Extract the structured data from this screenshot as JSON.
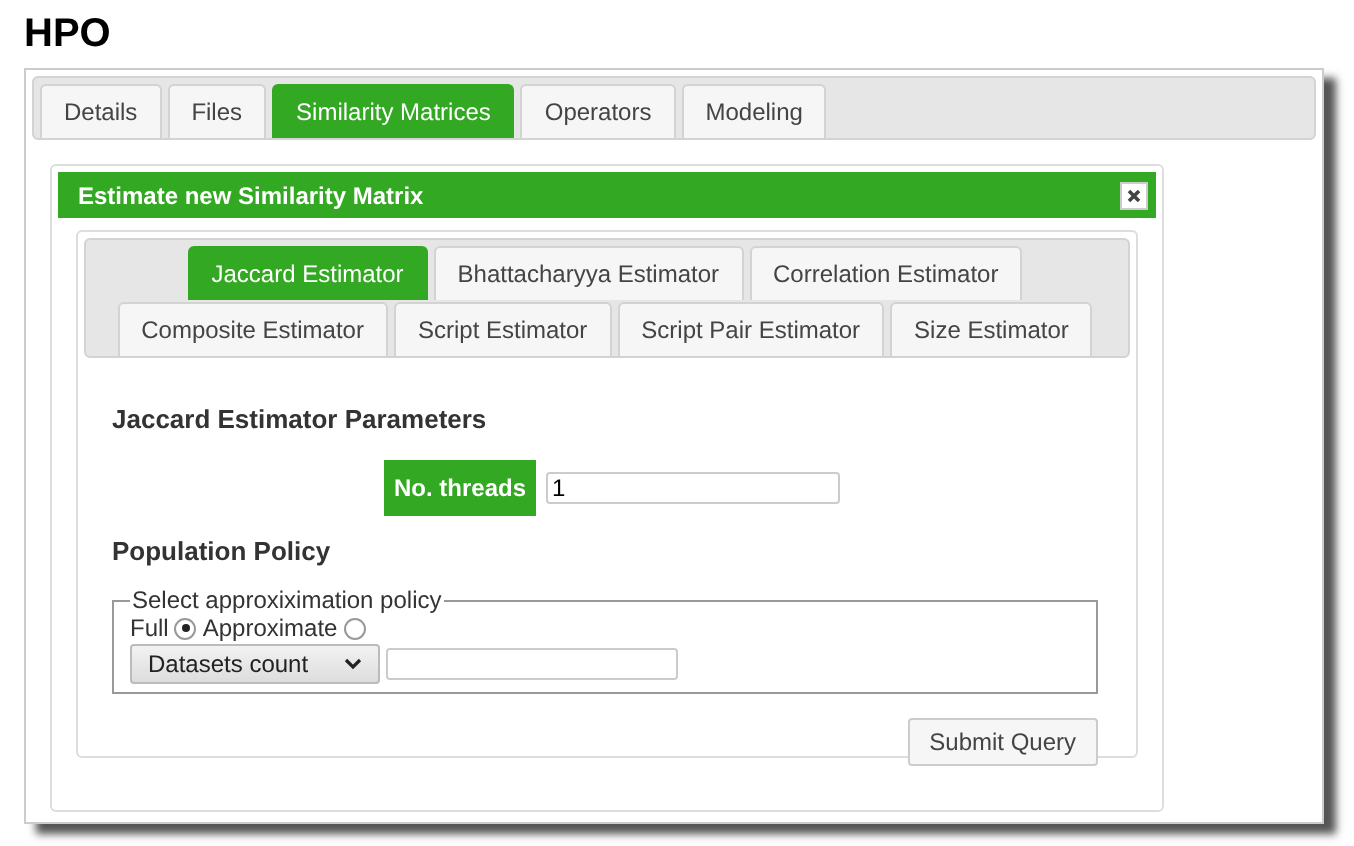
{
  "page_title": "HPO",
  "tabs": [
    {
      "label": "Details",
      "selected": false
    },
    {
      "label": "Files",
      "selected": false
    },
    {
      "label": "Similarity Matrices",
      "selected": true
    },
    {
      "label": "Operators",
      "selected": false
    },
    {
      "label": "Modeling",
      "selected": false
    }
  ],
  "dialog": {
    "title": "Estimate new Similarity Matrix",
    "estimator_tabs": [
      {
        "label": "Jaccard Estimator",
        "selected": true
      },
      {
        "label": "Bhattacharyya Estimator",
        "selected": false
      },
      {
        "label": "Correlation Estimator",
        "selected": false
      },
      {
        "label": "Composite Estimator",
        "selected": false
      },
      {
        "label": "Script Estimator",
        "selected": false
      },
      {
        "label": "Script Pair Estimator",
        "selected": false
      },
      {
        "label": "Size Estimator",
        "selected": false
      }
    ],
    "parameters_title": "Jaccard Estimator Parameters",
    "threads": {
      "label": "No. threads",
      "value": "1"
    },
    "population_title": "Population Policy",
    "policy": {
      "legend": "Select approxiximation policy",
      "options": [
        {
          "label": "Full",
          "selected": true
        },
        {
          "label": "Approximate",
          "selected": false
        }
      ],
      "select": {
        "value": "Datasets count"
      }
    },
    "submit": "Submit Query"
  }
}
